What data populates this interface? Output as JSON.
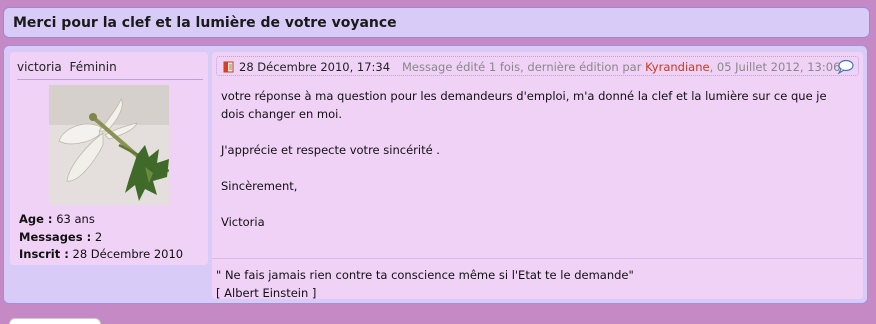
{
  "topic": {
    "title": "Merci pour la clef et la lumière de votre voyance"
  },
  "author": {
    "name": "victoria",
    "gender": "Féminin",
    "stats": {
      "age_label": "Age :",
      "age_value": "63 ans",
      "messages_label": "Messages :",
      "messages_value": "2",
      "joined_label": "Inscrit :",
      "joined_value": "28 Décembre 2010"
    }
  },
  "post": {
    "date": "28 Décembre 2010, 17:34",
    "edit_prefix": "Message édité 1 fois, dernière édition par",
    "edit_user": "Kyrandiane",
    "edit_suffix": ", 05 Juillet 2012, 13:06",
    "body": [
      "votre réponse à ma question pour les demandeurs d'emploi, m'a donné la clef et la lumière sur ce que je dois changer en moi.",
      "J'apprécie et respecte votre sincérité .",
      "Sincèrement,",
      "Victoria"
    ],
    "signature": [
      "\" Ne fais jamais rien contre ta conscience même si l'Etat te le demande\"",
      "[ Albert Einstein ]"
    ]
  },
  "icons": {
    "post": "post-icon",
    "quote": "quote-icon"
  },
  "colors": {
    "page_bg": "#c58ac6",
    "panel_bg": "#d9cbf8",
    "card_bg": "#f0d2f6",
    "edit_user": "#c43a1e"
  }
}
